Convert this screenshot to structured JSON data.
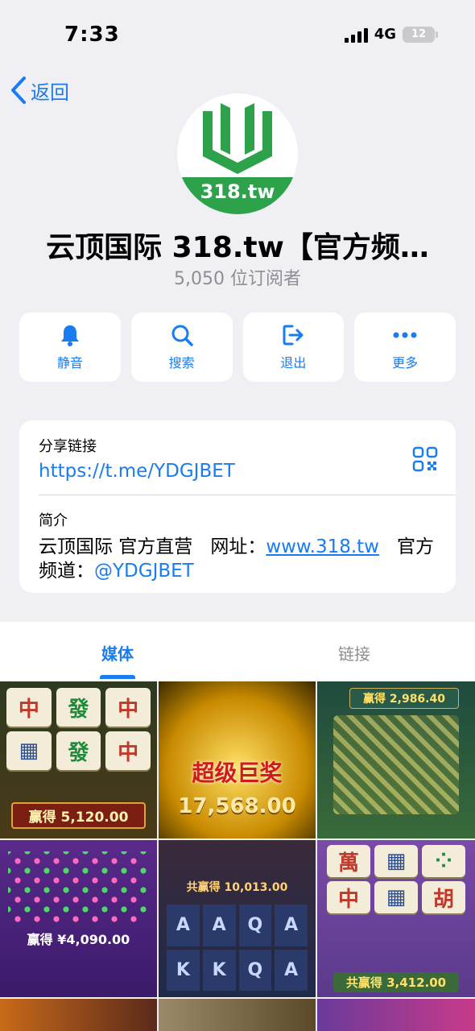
{
  "status_bar": {
    "time": "7:33",
    "network": "4G",
    "battery": "12"
  },
  "nav": {
    "back_label": "返回"
  },
  "channel": {
    "avatar_text": "318.tw",
    "title": "云顶国际 318.tw【官方频…",
    "subscribers": "5,050 位订阅者"
  },
  "actions": [
    {
      "label": "静音",
      "icon": "bell-icon"
    },
    {
      "label": "搜索",
      "icon": "search-icon"
    },
    {
      "label": "退出",
      "icon": "exit-icon"
    },
    {
      "label": "更多",
      "icon": "more-icon"
    }
  ],
  "info": {
    "share_label": "分享链接",
    "share_link": "https://t.me/YDGJBET",
    "bio_label": "简介",
    "bio_part1": "云顶国际 官方直营",
    "bio_part2": "网址：",
    "bio_url": "www.318.tw",
    "bio_part3": "官方频道：",
    "bio_handle": "@YDGJBET"
  },
  "tabs": {
    "media": "媒体",
    "links": "链接"
  },
  "media": [
    {
      "caption": "赢得 5,120.00"
    },
    {
      "banner": "超级巨奖",
      "caption": "17,568.00"
    },
    {
      "caption": "赢得 2,986.40"
    },
    {
      "caption": "赢得 ¥4,090.00"
    },
    {
      "caption": "共赢得 10,013.00"
    },
    {
      "caption": "共赢得 3,412.00"
    }
  ],
  "colors": {
    "accent": "#1a7cf1",
    "logo_green": "#2da24b",
    "background": "#efeff4"
  }
}
